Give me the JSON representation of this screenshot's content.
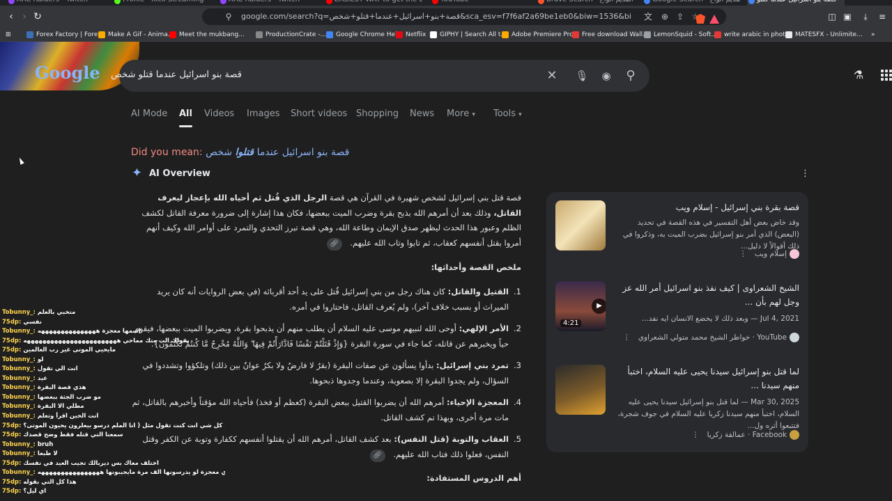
{
  "browser": {
    "tabs": [
      {
        "title": "ARC Raiders - Twitch",
        "color": "#9146ff"
      },
      {
        "title": "Profile - Kick Streaming",
        "color": "#53fc18"
      },
      {
        "title": "ARC Raiders - Twitch",
        "color": "#9146ff"
      },
      {
        "title": "EASIEST WAY to get the Best AQ",
        "color": "#ff0000"
      },
      {
        "title": "YouTube",
        "color": "#ff0000"
      },
      {
        "title": "Brave Search - الأشكال القديم أنواع",
        "color": "#fb542b"
      },
      {
        "title": "Google Search - الأشكال القديم أنواع",
        "color": "#4285f4"
      },
      {
        "title": "قصة بنو اسرائيل عندما قتلو",
        "color": "#4285f4",
        "active": true
      }
    ],
    "url": "google.com/search?q=قصة+بنو+اسرائيل+عندما+قتلو+شخص&sca_esv=f7f6af2a69be1eb0&biw=1536&bih=742&aic=0&ei=AQdvaYeCN4u...",
    "bookmarks": [
      {
        "label": "Forex Factory | Fore...",
        "color": "#3b6fb6"
      },
      {
        "label": "Make A Gif - Anima...",
        "color": "#f9ab00"
      },
      {
        "label": "Meet the mukbang...",
        "color": "#ff0000"
      },
      {
        "label": "ProductionCrate -...",
        "color": "#888888"
      },
      {
        "label": "Google Chrome Help",
        "color": "#4285f4"
      },
      {
        "label": "Netflix",
        "color": "#e50914"
      },
      {
        "label": "GIPHY | Search All t...",
        "color": "#ffffff"
      },
      {
        "label": "Adobe Premiere Pro...",
        "color": "#f9ab00"
      },
      {
        "label": "Free download Wall...",
        "color": "#e53935"
      },
      {
        "label": "LemonSquid - Soft...",
        "color": "#9aa0a6"
      },
      {
        "label": "write arabic in phot...",
        "color": "#e53935"
      },
      {
        "label": "MATESFX - Unlimite...",
        "color": "#e8eaed"
      }
    ]
  },
  "google": {
    "logo": "Google",
    "query": "قصة بنو اسرائيل عندما قتلو شخص",
    "tabs": [
      "AI Mode",
      "All",
      "Videos",
      "Images",
      "Short videos",
      "Shopping",
      "News",
      "More",
      "Tools"
    ],
    "active_tab": "All",
    "did_you_mean_label": "Did you mean:",
    "did_you_mean_prefix": "قصة بنو اسرائيل عندما",
    "did_you_mean_bold": "قتلوا",
    "did_you_mean_suffix": "شخص"
  },
  "overview": {
    "title": "AI Overview",
    "intro_1": "قصة قتل بني إسرائيل لشخص شهيرة في القرآن هي قصة",
    "intro_bold": "الرجل الذي قُتل ثم أحياه الله بإعجاز ليعرف القاتل،",
    "intro_2": "وذلك بعد أن أمرهم الله بذبح بقرة وضرب الميت ببعضها، فكان هذا إشارة إلى ضرورة معرفة القاتل لكشف الظلم وعبور هذا الحدث ليظهر صدق الإيمان وطاعة الله، وهي قصة تبرز التحدي والتمرد على أوامر الله وكيف أنهم أمروا بقتل أنفسهم كعقاب، ثم تابوا وتاب الله عليهم.",
    "summary_heading": "ملخص القصة وأحداثها:",
    "items": [
      {
        "n": "1.",
        "title": "القتيل والقاتل:",
        "text": "كان هناك رجل من بني إسرائيل قُتل على يد أحد أقربائه (في بعض الروايات أنه كان يريد الميراث أو بسبب خلاف آخر)، ولم يُعرف القاتل، فاحتاروا في أمره."
      },
      {
        "n": "2.",
        "title": "الأمر الإلهي:",
        "text": "أوحى الله لنبيهم موسى عليه السلام أن يطلب منهم أن يذبحوا بقرة، ويضربوا الميت ببعضها، فيقوم حياً ويخبرهم عن قاتله، كما جاء في سورة البقرة {وَإِذْ قَتَلْتُمْ نَفْسًا فَادَّارَأْتُمْ فِيهَا ۖ وَاللَّهُ مُخْرِجٌ مَّا كُنتُمْ تَكْتُمُونَ}."
      },
      {
        "n": "3.",
        "title": "تمرد بني إسرائيل:",
        "text": "بدأوا يسألون عن صفات البقرة (بقرٌ لا فارضٌ ولا بكرٌ عوانٌ بين ذلك) وتلكؤوا وتشددوا في السؤال، ولم يجدوا البقرة إلا بصعوبة، وعندما وجدوها ذبحوها."
      },
      {
        "n": "4.",
        "title": "المعجزة الإحياء:",
        "text": "أمرهم الله أن يضربوا القتيل ببعض البقرة (كعظم أو فخذ) فأحياه الله مؤقتاً وأخبرهم بالقاتل، ثم مات مرة أخرى، وبهذا تم كشف القاتل."
      },
      {
        "n": "5.",
        "title": "العقاب والتوبة (قتل النفس):",
        "text": "بعد كشف القاتل، أمرهم الله أن يقتلوا أنفسهم ككفارة وتوبة عن الكفر وقتل النفس، فعلوا ذلك فتاب الله عليهم."
      }
    ],
    "lessons_heading": "أهم الدروس المستفادة:"
  },
  "side_cards": [
    {
      "title": "قصة بقرة بني إسرائيل - إسلام ويب",
      "snippet": "وقد خاض بعض أهل التفسير في هذه القصة في تحديد (البعض) الذي أمر بنو إسرائيل بضرب الميت به، وذكروا في ذلك أقوالاً لا دليل...",
      "source": "إسلام ويب",
      "date": "",
      "duration": ""
    },
    {
      "title": "الشيخ الشعراوى | كيف نفذ بنو اسرائيل أمر الله عز وجل لهم بأن ...",
      "snippet": "Jul 4, 2021 — وبعد ذلك لا يخضع الانسان ايه نفد...",
      "source": "YouTube · خواطر الشيخ محمد متولي الشعراوي",
      "date": "",
      "duration": "4:21"
    },
    {
      "title": "لما قتل بنو إسرائيل سيدنا يحيى عليه السلام، اختبأ منهم سيدنا ...",
      "snippet": "Mar 30, 2025 — لما قتل بنو إسرائيل سيدنا يحيى عليه السلام، اختبأ منهم سيدنا زكريا عليه السلام في جوف شجرة، فتتبعوا أثره ول...",
      "source": "Facebook · عمالقة زكريا",
      "date": "",
      "duration": ""
    }
  ],
  "chat": [
    {
      "user": "Tobunny_",
      "msg": "متخبي بالعلم"
    },
    {
      "user": "75dp",
      "msg": "نفسي"
    },
    {
      "user": "Tobunny_",
      "msg": "اسمها معجزة هههههههههههههههه"
    },
    {
      "user": "75dp",
      "msg": "يقولك الت متك مماحي ههههههههههههههههههههههههه"
    },
    {
      "user": "75dp",
      "msg": "مايحيي الموتى غير رب العالمين"
    },
    {
      "user": "Tobunny_",
      "msg": "لو"
    },
    {
      "user": "Tobunny_",
      "msg": "انت الي تقول"
    },
    {
      "user": "Tobunny_",
      "msg": "عيد"
    },
    {
      "user": "Tobunny_",
      "msg": "هذي قصة البقرة"
    },
    {
      "user": "Tobunny_",
      "msg": "مو ضرب الجثة ببعضها"
    },
    {
      "user": "Tobunny_",
      "msg": "مطلي الا البقرة"
    },
    {
      "user": "Tobunny_",
      "msg": "انت الحين اقرأ وتعلم"
    },
    {
      "user": "75dp",
      "msg": "دقيقه قبل كل شي انت كنت تقول مثل ( انا الملم درسو بيعلرون يحيون الموتى؟"
    },
    {
      "user": "75dp",
      "msg": "سمعنا التي قتله فقط وضح قصدك"
    },
    {
      "user": "Tobunny_",
      "msg": "bruh"
    },
    {
      "user": "Tobunny_",
      "msg": "لا طبعا"
    },
    {
      "user": "75dp",
      "msg": "اختلف معاك بس ديربالك تجيب العيد في نفسك"
    },
    {
      "user": "Tobunny_",
      "msg": "هذي معجزة لو يدرسونها الف مرة مايجيبونها ههههههههههههههههه"
    },
    {
      "user": "75dp",
      "msg": "هذا كل التي بقوله"
    },
    {
      "user": "75dp",
      "msg": "اي ليل؟"
    }
  ],
  "colors": {
    "background": "#1f1f1f",
    "link": "#8ab4f8",
    "did_you_mean": "#f28b82",
    "chat_user": "#ffd54f"
  }
}
